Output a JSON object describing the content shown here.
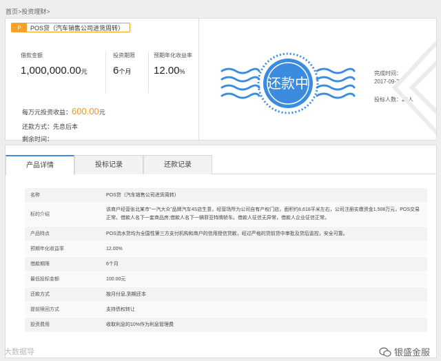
{
  "breadcrumb": {
    "home": "首页",
    "sep": ">",
    "current": "投资理财",
    "trail": ">"
  },
  "product": {
    "badge": "P",
    "title": "POS贷（汽车销售公司进货周转）"
  },
  "stats": {
    "amount_label": "借款金额",
    "amount_value": "1,000,000.00",
    "amount_unit": "元",
    "term_label": "投资期限",
    "term_value": "6",
    "term_unit": "个月",
    "rate_label": "预期年化收益率",
    "rate_value": "12.00",
    "rate_unit": "%"
  },
  "earnings": {
    "label": "每万元投资收益：",
    "amount": "600.00",
    "unit": "元"
  },
  "repay_method": "还款方式：先息后本",
  "remaining": "剩余时间：",
  "stamp": {
    "text": "还款中",
    "color": "#3b8cde"
  },
  "completion": {
    "label": "完成时间：",
    "date": "2017-09-25",
    "investors": "投标人数：23人"
  },
  "tabs": [
    {
      "label": "产品详情",
      "active": true
    },
    {
      "label": "投标记录",
      "active": false
    },
    {
      "label": "还款记录",
      "active": false
    }
  ],
  "details": [
    {
      "key": "名称",
      "value": "POS贷（汽车销售公司进货周转）"
    },
    {
      "key": "标的介绍",
      "value": "该商户经营张北某市“一汽大众”品牌汽车4S店生意，经营场所为公司自有产权门店，面积约6,618平米左右，公司注册实缴资金1,508万元，POS交易正常。借款人名下一套商品房;借款人名下一辆菲亚特牌轿车。借款人征信无异常，借款人企业征信正常。"
    },
    {
      "key": "产品特点",
      "value": "POS流水贷均为全国性第三方支付机构和商户的信用授信贷款，经过严格的贷前贷中审批及贷后监控，安全可靠。"
    },
    {
      "key": "预期年化收益率",
      "value": "12.00%"
    },
    {
      "key": "借款期限",
      "value": "6个月"
    },
    {
      "key": "最低投标金额",
      "value": "100.00元"
    },
    {
      "key": "还款方式",
      "value": "按月付息,到期还本"
    },
    {
      "key": "提前赎回方式",
      "value": "支持债权转让"
    },
    {
      "key": "投资费用",
      "value": "收取利息的10%作为利息管理费"
    }
  ],
  "watermark_left": "大数据导",
  "watermark_right": "银盛金服",
  "colors": {
    "accent_orange": "#f7a128",
    "accent_blue": "#3b8cde"
  }
}
